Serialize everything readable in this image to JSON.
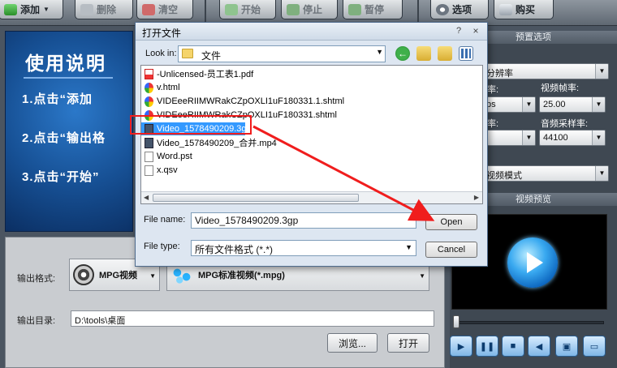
{
  "toolbar": {
    "add_label": "添加",
    "delete_label": "删除",
    "clear_label": "清空",
    "start_label": "开始",
    "stop_label": "停止",
    "pause_label": "暂停",
    "options_label": "选项",
    "buy_label": "购买"
  },
  "instructions": {
    "title": "使用说明",
    "step1": "1.点击“添加",
    "step2": "2.点击“输出格",
    "step3": "3.点击“开始”"
  },
  "output": {
    "format_label": "输出格式:",
    "format_value": "MPG视频",
    "format_detail": "MPG标准视频(*.mpg)",
    "dir_label": "输出目录:",
    "dir_value": "D:\\tools\\桌面",
    "browse_label": "浏览...",
    "open_label": "打开"
  },
  "right_panel": {
    "preset_header": "预置选项",
    "preset_value": "分辨率",
    "framerate_label": "视频帧率:",
    "framerate_value": "25.00",
    "left_value_1": "ps",
    "rate_label_left": "率:",
    "samplerate_label": "音频采样率:",
    "samplerate_value": "44100",
    "mode_value": "视频模式",
    "preview_header": "视频预览"
  },
  "dialog": {
    "title": "打开文件",
    "help": "?",
    "close": "×",
    "look_in_label": "Look in:",
    "look_in_value": "文件",
    "files": [
      {
        "name": "-Unlicensed-员工表1.pdf",
        "icon": "pdf-icon"
      },
      {
        "name": "v.html",
        "icon": "web-page-icon"
      },
      {
        "name": "VIDEeeRIIMWRakCZpOXLI1uF180331.1.shtml",
        "icon": "web-page-icon"
      },
      {
        "name": "VIDEeeRIIMWRakCZpOXLI1uF180331.shtml",
        "icon": "web-page-icon"
      },
      {
        "name": "Video_1578490209.3gp",
        "icon": "video-file-icon",
        "selected": true
      },
      {
        "name": "Video_1578490209_合并.mp4",
        "icon": "video-file-icon"
      },
      {
        "name": "Word.pst",
        "icon": "document-icon"
      },
      {
        "name": "x.qsv",
        "icon": "document-icon"
      }
    ],
    "file_name_label": "File name:",
    "file_name_value": "Video_1578490209.3gp",
    "file_type_label": "File type:",
    "file_type_value": "所有文件格式 (*.*)",
    "open_button": "Open",
    "cancel_button": "Cancel"
  },
  "colors": {
    "annotation": "#f01d1d",
    "selection": "#3399ff",
    "dialog_bg": "#dde6f1",
    "app_bg": "#4b5561"
  }
}
